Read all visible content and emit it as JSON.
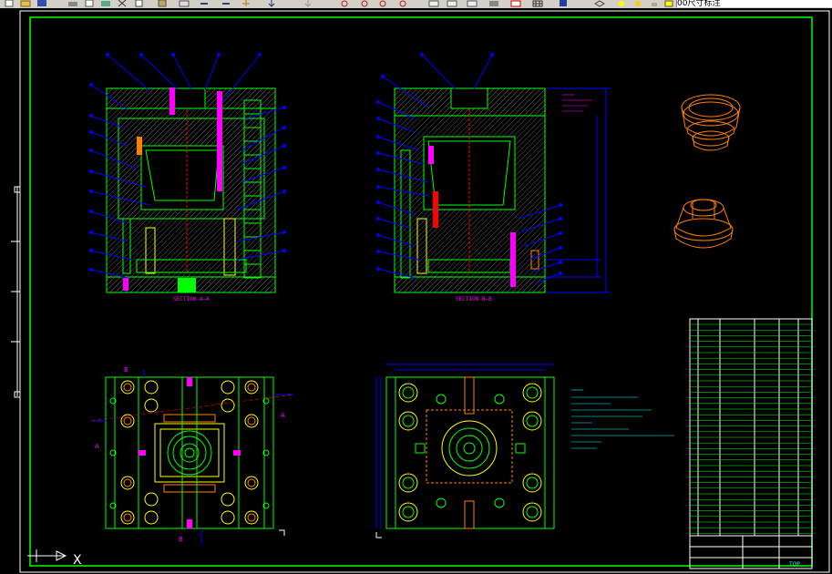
{
  "toolbar": {
    "buttons": [
      "new-icon",
      "open-icon",
      "save-icon",
      "print-icon",
      "preview-icon",
      "plot-icon",
      "cut-icon",
      "copy-icon",
      "paste-icon",
      "match-icon",
      "undo-icon",
      "redo-icon",
      "pan-icon",
      "zoom-realtime-icon",
      "zoom-window-icon",
      "zoom-previous-icon",
      "properties-icon",
      "design-center-icon",
      "tool-palette-icon",
      "markup-icon",
      "calculator-icon",
      "help-icon",
      "layer-icon",
      "layer-state-icon",
      "bulb-icon",
      "sun-icon",
      "lock-icon",
      "color-icon"
    ],
    "layer_name": "00尺寸标注"
  },
  "drawing": {
    "section_a_label": "SECTION A—A",
    "section_b_label": "SECTION B—B",
    "ucs_axis": "X",
    "cut_marks": {
      "a": "A",
      "b": "B"
    },
    "colors": {
      "background": "#000000",
      "frame": "#00ff00",
      "mold_plate": "#00ff00",
      "hatch": "#3a3a3a",
      "leader": "#0000ff",
      "part": "#ff8000",
      "dimension": "#00ffff",
      "label": "#ff00ff",
      "title_block": "#ffffff"
    }
  },
  "title_block": {
    "code": "TOP"
  }
}
